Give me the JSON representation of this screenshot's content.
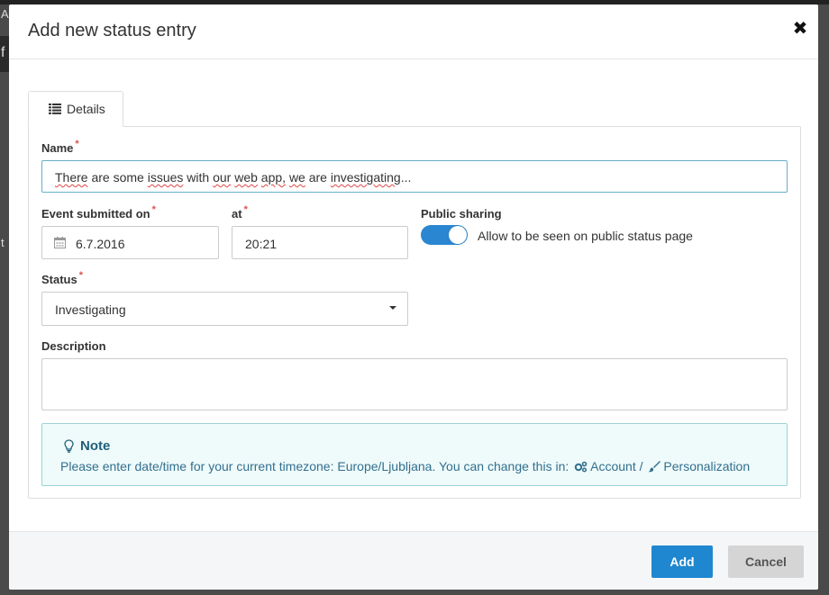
{
  "background": {
    "char_a": "A",
    "char_f": "f",
    "char_t": "t"
  },
  "modal": {
    "title": "Add new status entry",
    "close_glyph": "✖"
  },
  "tabs": [
    {
      "label": "Details",
      "icon": "list-icon",
      "active": true
    }
  ],
  "form": {
    "name": {
      "label": "Name",
      "required_mark": "*",
      "value_words": [
        "There",
        " are some ",
        "issues",
        " with ",
        "our",
        " ",
        "web",
        " ",
        "app,",
        " ",
        "we",
        " are ",
        "investigating",
        "..."
      ]
    },
    "event_date": {
      "label": "Event submitted on",
      "required_mark": "*",
      "value": "6.7.2016",
      "icon": "calendar-icon"
    },
    "event_time": {
      "label": "at",
      "required_mark": "*",
      "value": "20:21"
    },
    "public_sharing": {
      "label": "Public sharing",
      "toggle_label": "Allow to be seen on public status page",
      "enabled": true,
      "color": "#2b86d1"
    },
    "status": {
      "label": "Status",
      "required_mark": "*",
      "value": "Investigating"
    },
    "description": {
      "label": "Description",
      "value": ""
    }
  },
  "note": {
    "title": "Note",
    "text": "Please enter date/time for your current timezone: Europe/Ljubljana. You can change this in:",
    "account_link": "Account",
    "separator": "/",
    "personalization_link": "Personalization",
    "icon": "lightbulb-icon"
  },
  "footer": {
    "add_label": "Add",
    "cancel_label": "Cancel",
    "primary_color": "#1f87d0"
  }
}
